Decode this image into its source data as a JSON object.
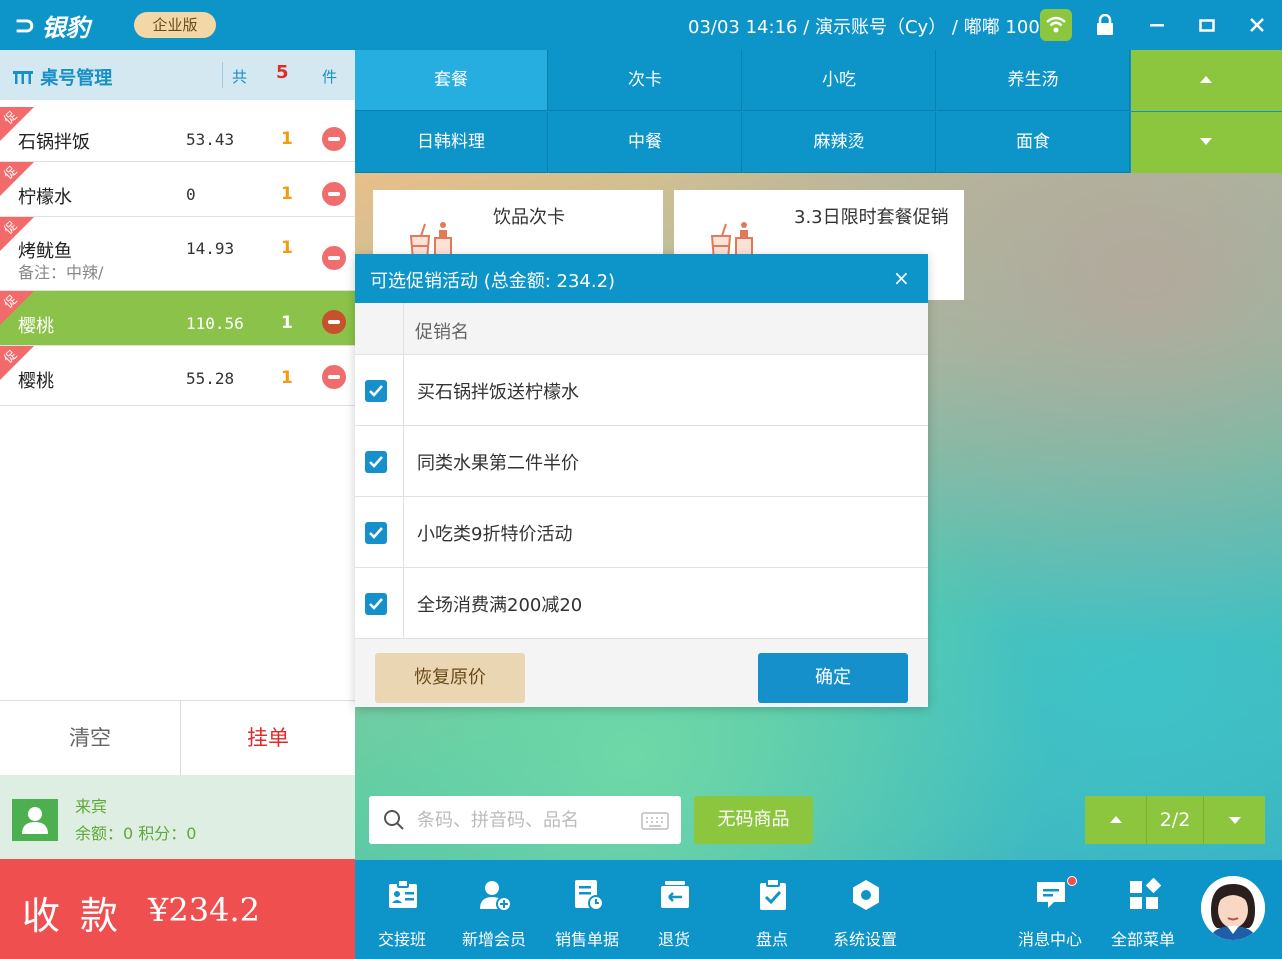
{
  "titlebar": {
    "brand": "银豹",
    "edition": "企业版",
    "status": "03/03 14:16 / 演示账号（Cy） / 嘟嘟 1001"
  },
  "order_panel": {
    "title": "桌号管理",
    "count_prefix": "共",
    "count": "5",
    "count_suffix": "件",
    "promo_tag": "促",
    "items": [
      {
        "name": "石锅拌饭",
        "price": "53.43",
        "qty": "1",
        "note": ""
      },
      {
        "name": "柠檬水",
        "price": "0",
        "qty": "1",
        "note": ""
      },
      {
        "name": "烤鱿鱼",
        "price": "14.93",
        "qty": "1",
        "note": "备注：中辣/"
      },
      {
        "name": "樱桃",
        "price": "110.56",
        "qty": "1",
        "note": ""
      },
      {
        "name": "樱桃",
        "price": "55.28",
        "qty": "1",
        "note": ""
      }
    ],
    "clear_label": "清空",
    "hang_label": "挂单",
    "member_name": "来宾",
    "member_balance": "余额：0 积分：0",
    "pay_label": "收款",
    "pay_amount": "¥234.2"
  },
  "categories": [
    "套餐",
    "次卡",
    "小吃",
    "养生汤",
    "日韩料理",
    "中餐",
    "麻辣烫",
    "面食"
  ],
  "products": [
    {
      "name": "饮品次卡"
    },
    {
      "name": "3.3日限时套餐促销"
    }
  ],
  "dialog": {
    "title": "可选促销活动  (总金额: 234.2)",
    "close": "×",
    "column_header": "促销名",
    "promotions": [
      {
        "name": "买石锅拌饭送柠檬水",
        "checked": true
      },
      {
        "name": "同类水果第二件半价",
        "checked": true
      },
      {
        "name": "小吃类9折特价活动",
        "checked": true
      },
      {
        "name": "全场消费满200减20",
        "checked": true
      }
    ],
    "restore_label": "恢复原价",
    "confirm_label": "确定"
  },
  "search": {
    "placeholder": "条码、拼音码、品名",
    "value": ""
  },
  "nocode_label": "无码商品",
  "pager": {
    "page": "2/2"
  },
  "toolbar": [
    {
      "label": "交接班",
      "icon": "handover-icon"
    },
    {
      "label": "新增会员",
      "icon": "add-member-icon"
    },
    {
      "label": "销售单据",
      "icon": "sales-receipt-icon"
    },
    {
      "label": "退货",
      "icon": "return-icon"
    },
    {
      "label": "盘点",
      "icon": "inventory-icon"
    },
    {
      "label": "系统设置",
      "icon": "settings-icon"
    },
    {
      "label": "消息中心",
      "icon": "message-icon"
    },
    {
      "label": "全部菜单",
      "icon": "menu-icon"
    }
  ],
  "colors": {
    "primary": "#0d94c9",
    "green": "#8cc63f",
    "red": "#f04f4f",
    "selected_row": "#8bc34a"
  }
}
